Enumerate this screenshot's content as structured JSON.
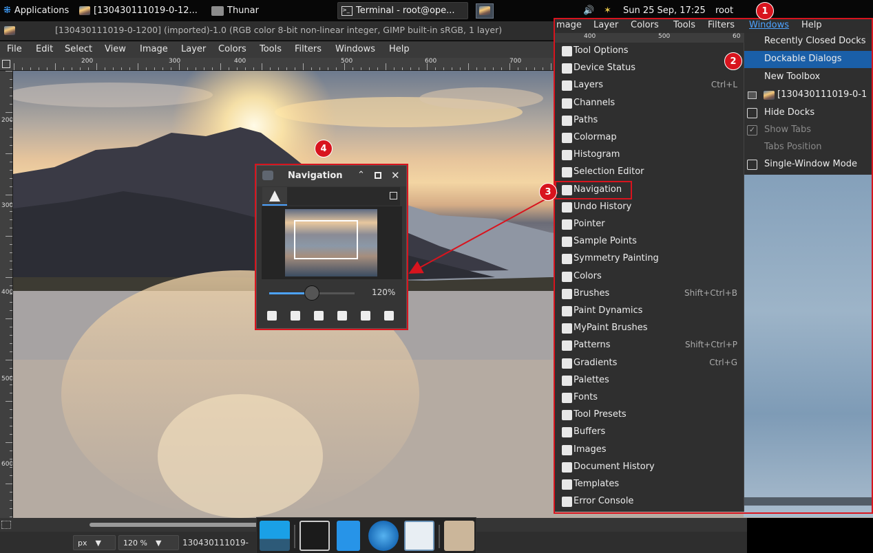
{
  "taskbar": {
    "applications": "Applications",
    "gimp_task": "[130430111019-0-12...",
    "thunar_task": "Thunar",
    "terminal_task": "Terminal - root@ope...",
    "clock": "Sun 25 Sep, 17:25",
    "user": "root"
  },
  "window": {
    "title": "[130430111019-0-1200] (imported)-1.0 (RGB color 8-bit non-linear integer, GIMP built-in sRGB, 1 layer)"
  },
  "menubar": [
    "File",
    "Edit",
    "Select",
    "View",
    "Image",
    "Layer",
    "Colors",
    "Tools",
    "Filters",
    "Windows",
    "Help"
  ],
  "menuhead": [
    "mage",
    "Layer",
    "Colors",
    "Tools",
    "Filters",
    "Windows",
    "Help"
  ],
  "ruler": {
    "h_labels": [
      "200",
      "300",
      "400",
      "500",
      "600",
      "700"
    ],
    "v_labels": [
      "200",
      "300",
      "400",
      "500",
      "600"
    ],
    "menu_labels": [
      "400",
      "500",
      "60"
    ]
  },
  "dockable_dialogs": [
    {
      "label": "Tool Options",
      "shortcut": "",
      "icon": "tool-options-icon"
    },
    {
      "label": "Device Status",
      "shortcut": "",
      "icon": "device-status-icon"
    },
    {
      "label": "Layers",
      "shortcut": "Ctrl+L",
      "icon": "layers-icon"
    },
    {
      "label": "Channels",
      "shortcut": "",
      "icon": "channels-icon"
    },
    {
      "label": "Paths",
      "shortcut": "",
      "icon": "paths-icon"
    },
    {
      "label": "Colormap",
      "shortcut": "",
      "icon": "colormap-icon"
    },
    {
      "label": "Histogram",
      "shortcut": "",
      "icon": "histogram-icon"
    },
    {
      "label": "Selection Editor",
      "shortcut": "",
      "icon": "selection-editor-icon"
    },
    {
      "label": "Navigation",
      "shortcut": "",
      "icon": "navigation-icon"
    },
    {
      "label": "Undo History",
      "shortcut": "",
      "icon": "undo-history-icon"
    },
    {
      "label": "Pointer",
      "shortcut": "",
      "icon": "pointer-icon"
    },
    {
      "label": "Sample Points",
      "shortcut": "",
      "icon": "sample-points-icon"
    },
    {
      "label": "Symmetry Painting",
      "shortcut": "",
      "icon": "symmetry-icon"
    },
    {
      "label": "Colors",
      "shortcut": "",
      "icon": "colors-icon"
    },
    {
      "label": "Brushes",
      "shortcut": "Shift+Ctrl+B",
      "icon": "brushes-icon"
    },
    {
      "label": "Paint Dynamics",
      "shortcut": "",
      "icon": "paint-dynamics-icon"
    },
    {
      "label": "MyPaint Brushes",
      "shortcut": "",
      "icon": "mypaint-brushes-icon"
    },
    {
      "label": "Patterns",
      "shortcut": "Shift+Ctrl+P",
      "icon": "patterns-icon"
    },
    {
      "label": "Gradients",
      "shortcut": "Ctrl+G",
      "icon": "gradients-icon"
    },
    {
      "label": "Palettes",
      "shortcut": "",
      "icon": "palettes-icon"
    },
    {
      "label": "Fonts",
      "shortcut": "",
      "icon": "fonts-icon"
    },
    {
      "label": "Tool Presets",
      "shortcut": "",
      "icon": "tool-presets-icon"
    },
    {
      "label": "Buffers",
      "shortcut": "",
      "icon": "buffers-icon"
    },
    {
      "label": "Images",
      "shortcut": "",
      "icon": "images-icon"
    },
    {
      "label": "Document History",
      "shortcut": "",
      "icon": "document-history-icon"
    },
    {
      "label": "Templates",
      "shortcut": "",
      "icon": "templates-icon"
    },
    {
      "label": "Error Console",
      "shortcut": "",
      "icon": "error-console-icon"
    }
  ],
  "windows_menu": [
    {
      "label": "Recently Closed Docks",
      "state": "normal"
    },
    {
      "label": "Dockable Dialogs",
      "state": "highlighted"
    },
    {
      "label": "New Toolbox",
      "state": "normal"
    },
    {
      "label": "[130430111019-0-1",
      "state": "normal"
    },
    {
      "label": "Hide Docks",
      "state": "unchecked"
    },
    {
      "label": "Show Tabs",
      "state": "checked-disabled"
    },
    {
      "label": "Tabs Position",
      "state": "disabled"
    },
    {
      "label": "Single-Window Mode",
      "state": "unchecked"
    }
  ],
  "navigation": {
    "title": "Navigation",
    "zoom": "120%",
    "zoom_fraction": 0.5
  },
  "status": {
    "unit": "px",
    "zoom": "120 %",
    "file": "130430111019-"
  },
  "badges": [
    "1",
    "2",
    "3",
    "4"
  ],
  "colors": {
    "annotation": "#d8141e",
    "highlight": "#1a5fa8",
    "accent": "#4da3ff"
  }
}
